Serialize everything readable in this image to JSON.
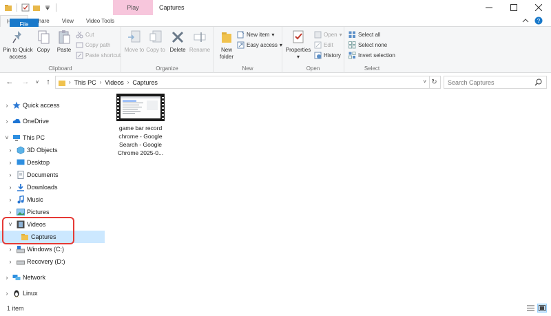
{
  "window": {
    "title": "Captures",
    "context_tab": "Play"
  },
  "ribbon_tabs": [
    "File",
    "Home",
    "Share",
    "View",
    "Video Tools"
  ],
  "clipboard": {
    "pin_label": "Pin to Quick access",
    "copy_label": "Copy",
    "paste_label": "Paste",
    "cut_label": "Cut",
    "copy_path_label": "Copy path",
    "paste_shortcut_label": "Paste shortcut",
    "group_label": "Clipboard"
  },
  "organize": {
    "move_label": "Move to",
    "copyto_label": "Copy to",
    "delete_label": "Delete",
    "rename_label": "Rename",
    "group_label": "Organize"
  },
  "new": {
    "folder_label": "New folder",
    "new_item_label": "New item",
    "easy_access_label": "Easy access",
    "group_label": "New"
  },
  "open": {
    "properties_label": "Properties",
    "open_label": "Open",
    "edit_label": "Edit",
    "history_label": "History",
    "group_label": "Open"
  },
  "select": {
    "select_all_label": "Select all",
    "select_none_label": "Select none",
    "invert_label": "Invert selection",
    "group_label": "Select"
  },
  "address": {
    "crumbs": [
      "This PC",
      "Videos",
      "Captures"
    ]
  },
  "search": {
    "placeholder": "Search Captures"
  },
  "nav": {
    "quick_access": "Quick access",
    "onedrive": "OneDrive",
    "this_pc": "This PC",
    "objects3d": "3D Objects",
    "desktop": "Desktop",
    "documents": "Documents",
    "downloads": "Downloads",
    "music": "Music",
    "pictures": "Pictures",
    "videos": "Videos",
    "captures": "Captures",
    "windows_c": "Windows (C:)",
    "recovery_d": "Recovery (D:)",
    "network": "Network",
    "linux": "Linux"
  },
  "files": [
    {
      "name": "game bar record chrome - Google Search - Google Chrome 2025-0..."
    }
  ],
  "status": {
    "count": "1 item"
  },
  "colors": {
    "file_tab": "#1979ca",
    "play_tab": "#f7c6dc",
    "selected": "#cce8ff",
    "highlight": "#e53935"
  }
}
